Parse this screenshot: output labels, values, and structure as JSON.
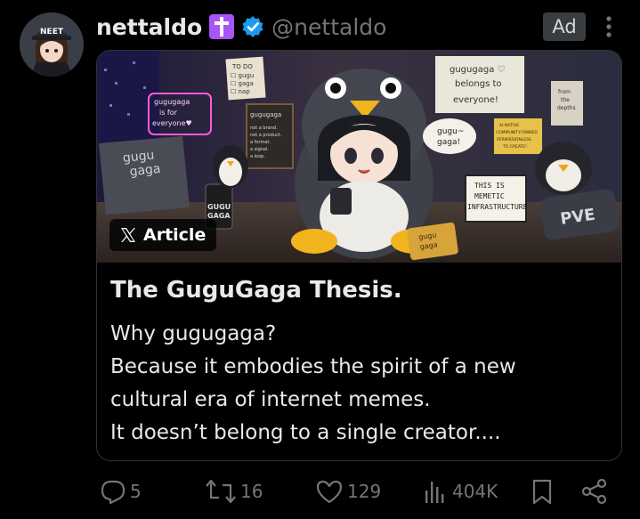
{
  "author": {
    "display_name": "nettaldo",
    "handle": "@nettaldo",
    "avatar_cap_text": "NEET"
  },
  "ad_label": "Ad",
  "article": {
    "chip_label": "Article",
    "title": "The GuguGaga Thesis.",
    "body_lines": [
      "Why gugugaga?",
      "Because it embodies the spirit of a new",
      "cultural era of internet memes.",
      "It doesn’t belong to a single creator...."
    ]
  },
  "image_signs": {
    "neon": [
      "gugugaga",
      "is for",
      "everyone♥"
    ],
    "todo": [
      "TO DO",
      "☐ gugu",
      "☐ gaga",
      "☐ nap"
    ],
    "board_top": "gugugaga",
    "board_lines": [
      "not a brand.",
      "not a product.",
      "a format.",
      "a signal.",
      "a loop."
    ],
    "sticky_note": [
      "gugugaga ♡",
      "belongs to",
      "everyone!"
    ],
    "small_note": [
      "from",
      "the",
      "depths"
    ],
    "yellow_note": [
      "AI-NATIVE",
      "COMMUNITY-OWNED",
      "PERMISSIONLESS",
      "TO CREATE!"
    ],
    "bubble": [
      "gugu~",
      "gaga!"
    ],
    "lightbox": [
      "THIS IS",
      "MEMETIC",
      "INFRASTRUCTURE"
    ],
    "can": [
      "GUGU",
      "GAGA"
    ],
    "laptop": [
      "gugu",
      "gaga"
    ],
    "bag": [
      "gugu",
      "gaga"
    ],
    "pillow": "PVE"
  },
  "actions": {
    "replies": "5",
    "reposts": "16",
    "likes": "129",
    "views": "404K"
  },
  "icons": {
    "verified": "verified-badge-icon",
    "cross": "latin-cross-icon",
    "more": "more-dots-icon",
    "x_logo": "x-logo-icon",
    "reply": "reply-icon",
    "repost": "repost-icon",
    "like": "heart-icon",
    "views": "views-chart-icon",
    "bookmark": "bookmark-icon",
    "share": "share-icon"
  },
  "colors": {
    "background": "#000000",
    "text_primary": "#e7e9ea",
    "text_secondary": "#71767b",
    "verified_blue": "#1d9bf0",
    "cross_badge": "#a855f7",
    "card_border": "#2f3336"
  }
}
